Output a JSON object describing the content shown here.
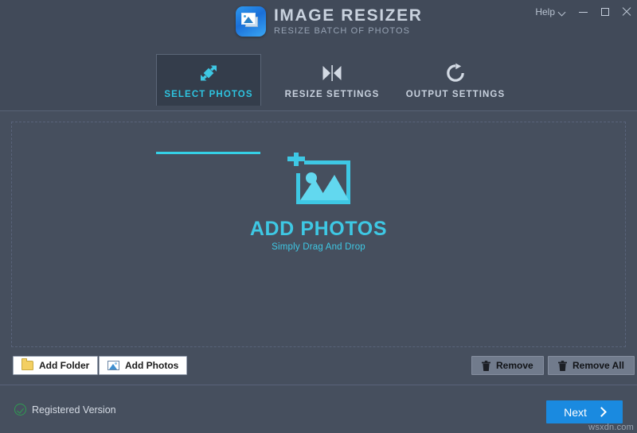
{
  "window": {
    "app_title": "IMAGE RESIZER",
    "app_subtitle": "RESIZE BATCH OF PHOTOS",
    "app_icon": "image-stack-icon",
    "help_label": "Help",
    "help_chevron_icon": "chevron-down-icon",
    "minimize_icon": "minimize-icon",
    "maximize_icon": "maximize-icon",
    "close_icon": "close-icon"
  },
  "tabs": [
    {
      "id": "select-photos",
      "label": "SELECT PHOTOS",
      "icon": "expand-arrows-icon",
      "active": true
    },
    {
      "id": "resize-settings",
      "label": "RESIZE SETTINGS",
      "icon": "resize-hourglass-icon",
      "active": false
    },
    {
      "id": "output-settings",
      "label": "OUTPUT SETTINGS",
      "icon": "refresh-circle-arrow-icon",
      "active": false
    }
  ],
  "dropzone": {
    "icon": "add-photo-icon",
    "title": "ADD PHOTOS",
    "subtitle": "Simply Drag And Drop"
  },
  "toolbar": {
    "add_folder_label": "Add Folder",
    "add_folder_icon": "folder-icon",
    "add_photos_label": "Add Photos",
    "add_photos_icon": "photo-icon",
    "remove_label": "Remove",
    "remove_icon": "trash-icon",
    "remove_all_label": "Remove All",
    "remove_all_icon": "trash-icon"
  },
  "footer": {
    "registered_label": "Registered Version",
    "registered_icon": "check-circle-icon",
    "next_label": "Next",
    "next_icon": "chevron-right-icon",
    "watermark": "wsxdn.com"
  },
  "colors": {
    "window_bg": "#464f5e",
    "header_bg": "#414a59",
    "active_tab_bg": "#343d4b",
    "accent_cyan": "#3ec8e4",
    "accent_blue": "#1a8ae0",
    "registered_green": "#2f9c52"
  }
}
